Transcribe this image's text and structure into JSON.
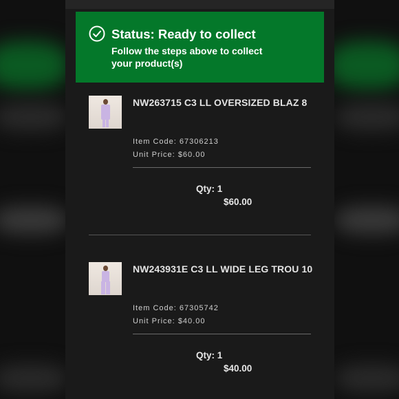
{
  "status": {
    "icon": "check-circle-icon",
    "title": "Status: Ready to collect",
    "description": "Follow the steps above to collect your product(s)",
    "color": "#04782a"
  },
  "items": [
    {
      "name": "NW263715 C3 LL OVERSIZED BLAZ 8",
      "item_code_label": "Item Code:",
      "item_code": "67306213",
      "unit_price_label": "Unit Price:",
      "unit_price": "$60.00",
      "qty": "Qty: 1",
      "total": "$60.00"
    },
    {
      "name": "NW243931E C3 LL WIDE LEG TROU 10",
      "item_code_label": "Item Code:",
      "item_code": "67305742",
      "unit_price_label": "Unit Price:",
      "unit_price": "$40.00",
      "qty": "Qty: 1",
      "total": "$40.00"
    }
  ]
}
